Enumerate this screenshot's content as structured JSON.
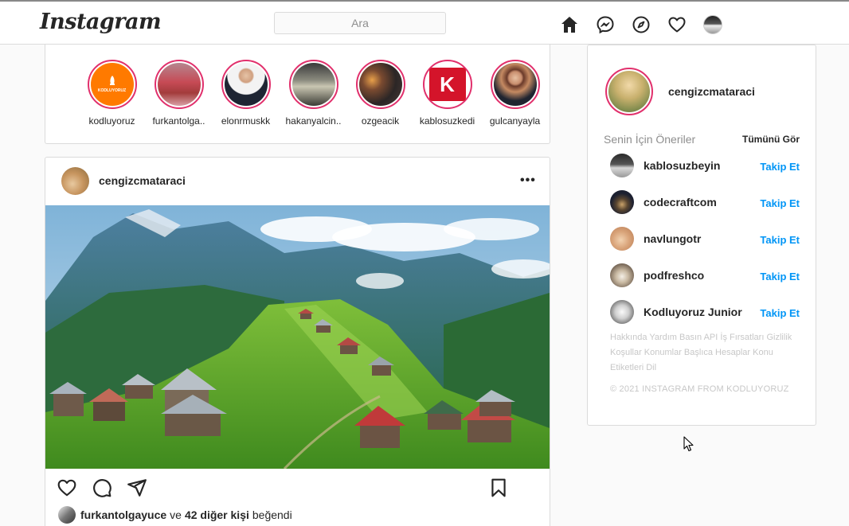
{
  "header": {
    "logo_text": "Instagram",
    "search_placeholder": "Ara",
    "icons": [
      "home-icon",
      "messenger-icon",
      "explore-icon",
      "heart-icon",
      "profile-avatar"
    ]
  },
  "stories": [
    {
      "username": "kodluyoruz",
      "pic_label": "KODLUYORUZ"
    },
    {
      "username": "furkantolga.."
    },
    {
      "username": "elonrmuskk"
    },
    {
      "username": "hakanyalcin.."
    },
    {
      "username": "ozgeacik"
    },
    {
      "username": "kablosuzkedi",
      "pic_label": "K"
    },
    {
      "username": "gulcanyayla"
    }
  ],
  "post": {
    "username": "cengizcmataraci",
    "more": "•••",
    "liked_by": "furkantolgayuce",
    "liked_connector": "ve",
    "liked_others": "42 diğer kişi",
    "liked_suffix": "beğendi"
  },
  "sidebar": {
    "username": "cengizcmataraci",
    "suggestions_title": "Senin İçin Öneriler",
    "see_all": "Tümünü Gör",
    "suggestions": [
      {
        "username": "kablosuzbeyin",
        "action": "Takip Et"
      },
      {
        "username": "codecraftcom",
        "action": "Takip Et"
      },
      {
        "username": "navlungotr",
        "action": "Takip Et"
      },
      {
        "username": "podfreshco",
        "action": "Takip Et"
      },
      {
        "username": "Kodluyoruz Junior",
        "action": "Takip Et"
      }
    ],
    "footer_links": "Hakkında Yardım Basın API İş Fırsatları Gizlilik Koşullar Konumlar Başlıca Hesaplar Konu Etiketleri Dil",
    "copyright": "© 2021 INSTAGRAM FROM KODLUYORUZ"
  },
  "colors": {
    "story_ring": "#e1306c",
    "follow_blue": "#0095f6",
    "kodluyoruz_orange": "#ff7a00",
    "kablosuzkedi_red": "#d4142a"
  }
}
